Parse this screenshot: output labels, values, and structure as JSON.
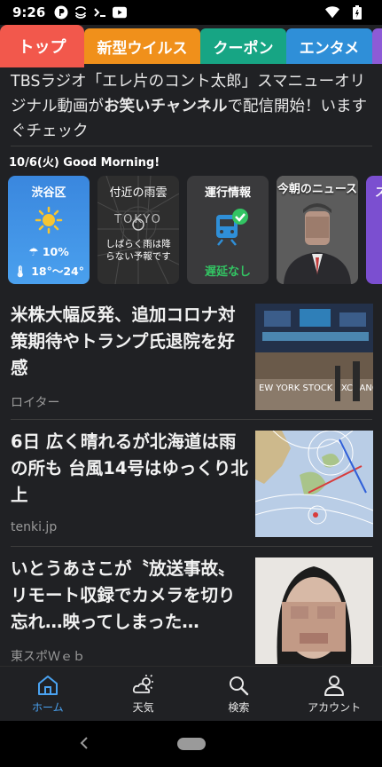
{
  "status_bar": {
    "time": "9:26",
    "icons": [
      "p-badge-icon",
      "cloud-icon",
      "terminal-icon",
      "youtube-icon",
      "wifi-icon",
      "battery-icon"
    ]
  },
  "tabs": [
    {
      "label": "トップ",
      "color": "#f2584c",
      "active": true
    },
    {
      "label": "新型ウイルス",
      "color": "#f0901b",
      "active": false
    },
    {
      "label": "クーポン",
      "color": "#17a584",
      "active": false
    },
    {
      "label": "エンタメ",
      "color": "#2f8fd8",
      "active": false
    },
    {
      "label": "",
      "color": "#8d5bd6",
      "active": false
    }
  ],
  "headline": {
    "part1": "TBSラジオ「エレ片のコント太郎」スマニューオリジナル動画が",
    "bold": "お笑いチャンネル",
    "part2": "で配信開始！いますぐチェック"
  },
  "greeting": "10/6(火) Good Morning!",
  "cards": {
    "weather": {
      "title": "渋谷区",
      "rain": "10%",
      "temp": "18°〜24°",
      "bg": "#3d8fe0"
    },
    "rain_radar": {
      "title": "付近の雨雲",
      "map_label": "TOKYO",
      "note": "しばらく雨は降らない予報です"
    },
    "transit": {
      "title": "運行情報",
      "status": "遅延なし",
      "status_color": "#33c463"
    },
    "news_person": {
      "title": "今朝のニュース"
    },
    "partial": {
      "title": "ス"
    }
  },
  "articles": [
    {
      "title": "米株大幅反発、追加コロナ対策期待やトランプ氏退院を好感",
      "source": "ロイター",
      "thumb": "stock-exchange-photo"
    },
    {
      "title": "6日 広く晴れるが北海道は雨の所も 台風14号はゆっくり北上",
      "source": "tenki.jp",
      "thumb": "weather-map-photo"
    },
    {
      "title": "いとうあさこが〝放送事故〟リモート収録でカメラを切り忘れ…映ってしまった…",
      "source": "東スポＷｅｂ",
      "thumb": "person-photo"
    }
  ],
  "bottom_nav": [
    {
      "label": "ホーム",
      "icon": "home-icon",
      "active": true
    },
    {
      "label": "天気",
      "icon": "weather-icon",
      "active": false
    },
    {
      "label": "検索",
      "icon": "search-icon",
      "active": false
    },
    {
      "label": "アカウント",
      "icon": "account-icon",
      "active": false
    }
  ],
  "colors": {
    "background": "#202124",
    "active_nav": "#4aa3f2"
  }
}
